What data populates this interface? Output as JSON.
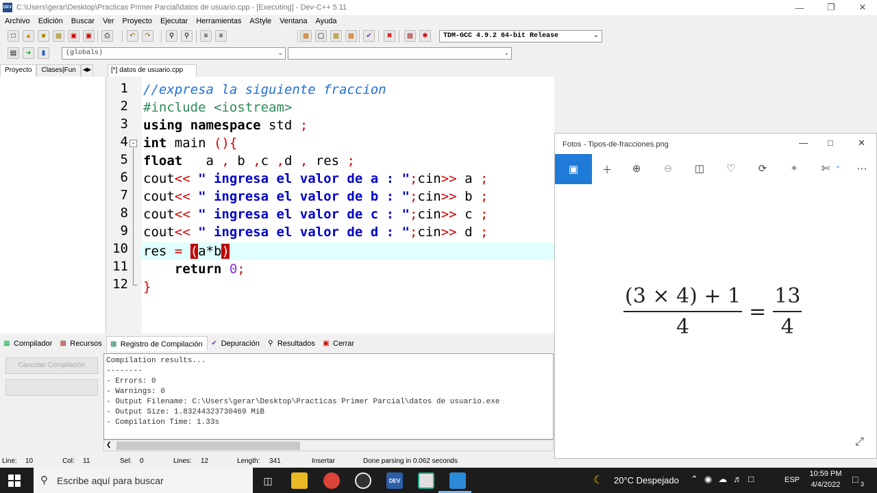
{
  "window": {
    "title": "C:\\Users\\gerar\\Desktop\\Practicas Primer Parcial\\datos de usuario.cpp - [Executing] - Dev-C++ 5.11",
    "app_icon_text": "DEV"
  },
  "menu": [
    "Archivo",
    "Edición",
    "Buscar",
    "Ver",
    "Proyecto",
    "Ejecutar",
    "Herramientas",
    "AStyle",
    "Ventana",
    "Ayuda"
  ],
  "toolbar": {
    "compiler": "TDM-GCC 4.9.2 64-bit Release",
    "scope": "(globals)",
    "function": ""
  },
  "left_tabs": [
    "Proyecto",
    "Clases|Fun"
  ],
  "editor": {
    "tab_label": "[*] datos de usuario.cpp",
    "line_numbers": [
      "1",
      "2",
      "3",
      "4",
      "5",
      "6",
      "7",
      "8",
      "9",
      "10",
      "11",
      "12"
    ],
    "highlight_color": "#e0ffff",
    "lines": {
      "l1": "//expresa la siguiente fraccion",
      "l2": "#include <iostream>",
      "l3_kw": "using namespace",
      "l3_rest": " std ",
      "l3_sym": ";",
      "l4_kw": "int",
      "l4_rest": " main ",
      "l4_sym": "(){",
      "l5_kw": "float",
      "l5_a": "   a ",
      "l5_c1": ",",
      "l5_b": " b ",
      "l5_c2": ",",
      "l5_c": "c ",
      "l5_c3": ",",
      "l5_d": "d ",
      "l5_c4": ",",
      "l5_res": " res ",
      "l5_semi": ";",
      "cout": "cout",
      "op_out": "<<",
      "cin": "cin",
      "op_in": ">>",
      "semi": ";",
      "l6_str": " \" ingresa el valor de a : \"",
      "l6_var": " a ",
      "l7_str": " \" ingresa el valor de b : \"",
      "l7_var": " b ",
      "l8_str": " \" ingresa el valor de c : \"",
      "l8_var": " c ",
      "l9_str": " \" ingresa el valor de d : \"",
      "l9_var": " d ",
      "l10_a": "res ",
      "l10_eq": "= ",
      "l10_open": "(",
      "l10_mid": "a*b",
      "l10_close": ")",
      "l11_indent": "    ",
      "l11_kw": "return",
      "l11_num": " 0",
      "l11_semi": ";",
      "l12": "}"
    }
  },
  "bottom_tabs": [
    "Compilador",
    "Recursos",
    "Registro de Compilación",
    "Depuración",
    "Resultados",
    "Cerrar"
  ],
  "cancel_button": "Cancelar Compilación",
  "output_lines": [
    "Compilation results...",
    "--------",
    "- Errors: 0",
    "- Warnings: 0",
    "- Output Filename: C:\\Users\\gerar\\Desktop\\Practicas Primer Parcial\\datos de usuario.exe",
    "- Output Size: 1.83244323730469 MiB",
    "- Compilation Time: 1.33s"
  ],
  "status": {
    "line_label": "Line:",
    "line_val": "10",
    "col_label": "Col:",
    "col_val": "11",
    "sel_label": "Sel:",
    "sel_val": "0",
    "lines_label": "Lines:",
    "lines_val": "12",
    "length_label": "Length:",
    "length_val": "341",
    "mode": "Insertar",
    "message": "Done parsing in 0.062 seconds"
  },
  "photos": {
    "title": "Fotos - Tipos-de-fracciones.png",
    "accent": "#1f7ad8",
    "equation": {
      "num_left": "(3 × 4) + 1",
      "den_left": "4",
      "equals": "=",
      "num_right": "13",
      "den_right": "4"
    }
  },
  "taskbar": {
    "search_placeholder": "Escribe aquí para buscar",
    "weather": "20°C  Despejado",
    "lang": "ESP",
    "time": "10:59 PM",
    "date": "4/4/2022",
    "notif_count": "3"
  }
}
